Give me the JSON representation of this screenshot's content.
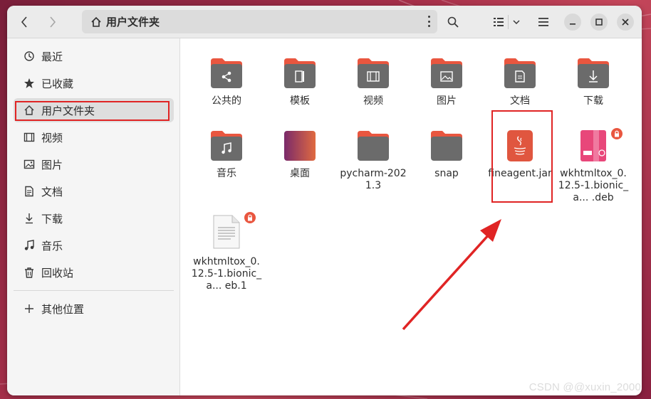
{
  "window": {
    "path_title": "用户文件夹",
    "back_icon": "chevron-left-icon",
    "forward_icon": "chevron-right-icon",
    "search_icon": "search-icon",
    "view_icon": "list-view-icon",
    "menu_icon": "hamburger-icon",
    "controls": [
      "minimize",
      "maximize",
      "close"
    ]
  },
  "sidebar": {
    "items": [
      {
        "label": "最近",
        "icon": "clock-icon"
      },
      {
        "label": "已收藏",
        "icon": "star-icon"
      },
      {
        "label": "用户文件夹",
        "icon": "home-icon",
        "active": true
      },
      {
        "label": "视频",
        "icon": "film-icon"
      },
      {
        "label": "图片",
        "icon": "image-icon"
      },
      {
        "label": "文档",
        "icon": "document-icon"
      },
      {
        "label": "下载",
        "icon": "download-icon"
      },
      {
        "label": "音乐",
        "icon": "music-icon"
      },
      {
        "label": "回收站",
        "icon": "trash-icon"
      }
    ],
    "other": {
      "label": "其他位置",
      "icon": "plus-icon"
    }
  },
  "files": [
    {
      "name": "公共的",
      "type": "folder",
      "emblem": "share"
    },
    {
      "name": "模板",
      "type": "folder",
      "emblem": "template"
    },
    {
      "name": "视频",
      "type": "folder",
      "emblem": "film"
    },
    {
      "name": "图片",
      "type": "folder",
      "emblem": "image"
    },
    {
      "name": "文档",
      "type": "folder",
      "emblem": "document"
    },
    {
      "name": "下载",
      "type": "folder",
      "emblem": "download"
    },
    {
      "name": "音乐",
      "type": "folder",
      "emblem": "music"
    },
    {
      "name": "桌面",
      "type": "desktop-folder"
    },
    {
      "name": "pycharm-2021.3",
      "type": "folder"
    },
    {
      "name": "snap",
      "type": "folder"
    },
    {
      "name": "fineagent.jar",
      "type": "jar"
    },
    {
      "name": "wkhtmltox_0.12.5-1.bionic_a... .deb",
      "type": "deb",
      "locked": true
    },
    {
      "name": "wkhtmltox_0.12.5-1.bionic_a... eb.1",
      "type": "text",
      "locked": true
    }
  ],
  "colors": {
    "folder_top": "#e9563f",
    "folder_body": "#6b6b6b",
    "highlight": "#e02424",
    "jar": "#e0563f",
    "deb": "#e8477a"
  },
  "watermark": "CSDN @@xuxin_2000"
}
